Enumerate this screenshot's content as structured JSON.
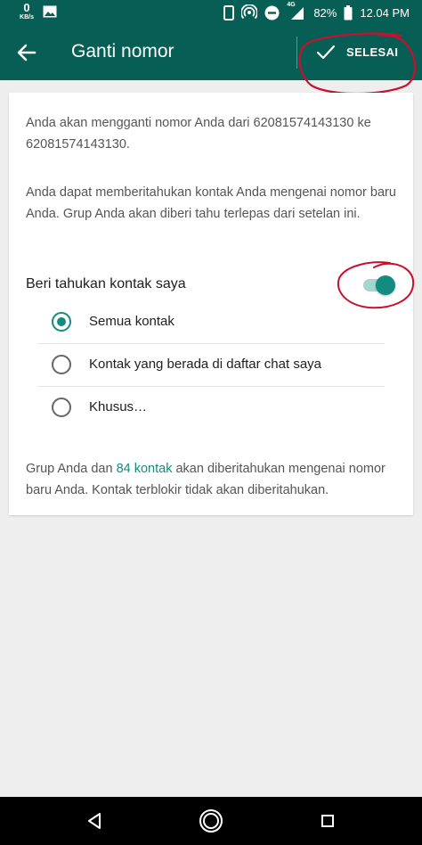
{
  "status_bar": {
    "net_speed_value": "0",
    "net_speed_unit": "KB/s",
    "network_type": "4G",
    "battery": "82%",
    "time": "12.04 PM"
  },
  "app_bar": {
    "title": "Ganti nomor",
    "done_label": "SELESAI"
  },
  "content": {
    "intro": "Anda akan mengganti nomor Anda dari 62081574143130 ke 62081574143130.",
    "notify_info": "Anda dapat memberitahukan kontak Anda mengenai nomor baru Anda. Grup Anda akan diberi tahu terlepas dari setelan ini.",
    "notify_label": "Beri tahukan kontak saya",
    "notify_enabled": true,
    "options": [
      {
        "label": "Semua kontak",
        "selected": true
      },
      {
        "label": "Kontak yang berada di daftar chat saya",
        "selected": false
      },
      {
        "label": "Khusus…",
        "selected": false
      }
    ],
    "footer": {
      "before": "Grup Anda dan ",
      "link": "84 kontak",
      "after": " akan diberitahukan mengenai nomor baru Anda. Kontak terblokir tidak akan diberitahukan."
    }
  },
  "colors": {
    "app_bar": "#075e54",
    "accent": "#128c7e",
    "annotation": "#c8102e"
  },
  "icons": [
    "back-arrow-icon",
    "check-icon",
    "back-triangle-icon",
    "home-circle-icon",
    "recents-square-icon"
  ]
}
